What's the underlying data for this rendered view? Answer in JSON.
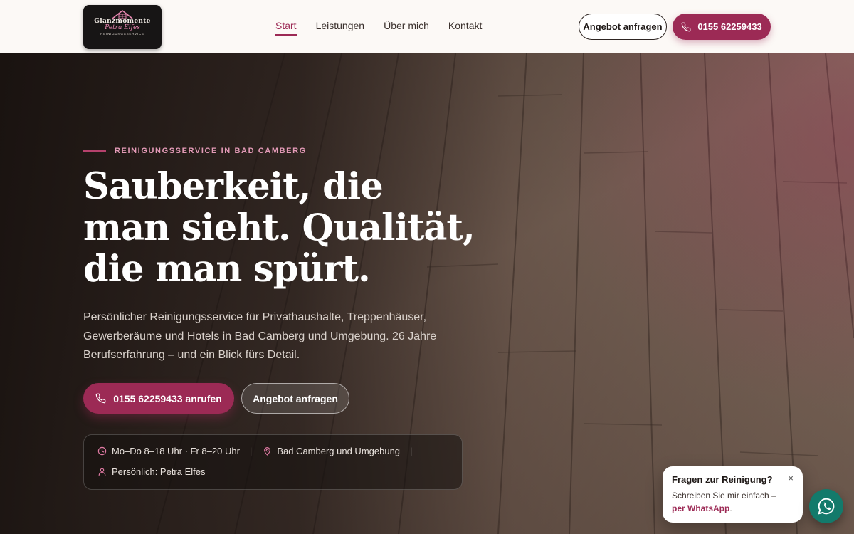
{
  "brand": {
    "name": "Glanzmomente",
    "script": "Petra Elfes",
    "tagline": "REINIGUNGSSERVICE"
  },
  "nav": {
    "items": [
      {
        "label": "Start",
        "active": true
      },
      {
        "label": "Leistungen",
        "active": false
      },
      {
        "label": "Über mich",
        "active": false
      },
      {
        "label": "Kontakt",
        "active": false
      }
    ]
  },
  "header": {
    "quote_label": "Angebot anfragen",
    "phone_label": "0155 62259433"
  },
  "hero": {
    "kicker": "REINIGUNGSSERVICE IN BAD CAMBERG",
    "headline_lines": [
      "Sauberkeit, die",
      "man sieht. Qualität,",
      "die man spürt."
    ],
    "lead": "Persönlicher Reinigungsservice für Privathaushalte, Treppenhäuser, Gewerberäume und Hotels in Bad Camberg und Umgebung. 26 Jahre Berufserfahrung – und ein Blick fürs Detail.",
    "call_button": "0155 62259433 anrufen",
    "offer_button": "Angebot anfragen",
    "info": {
      "hours": "Mo–Do 8–18 Uhr · Fr 8–20 Uhr",
      "location": "Bad Camberg und Umgebung",
      "person": "Persönlich: Petra Elfes"
    }
  },
  "chat": {
    "title": "Fragen zur Reinigung?",
    "body": "Schreiben Sie mir einfach –",
    "link": "per WhatsApp",
    "link_suffix": ".",
    "close": "×"
  },
  "colors": {
    "accent": "#9c2a55",
    "kicker": "#e39ab7",
    "header_bg": "#fcf9f6",
    "whatsapp": "#137a6b"
  },
  "icons": [
    "phone-icon",
    "clock-icon",
    "location-pin-icon",
    "person-icon",
    "close-icon",
    "whatsapp-icon"
  ]
}
